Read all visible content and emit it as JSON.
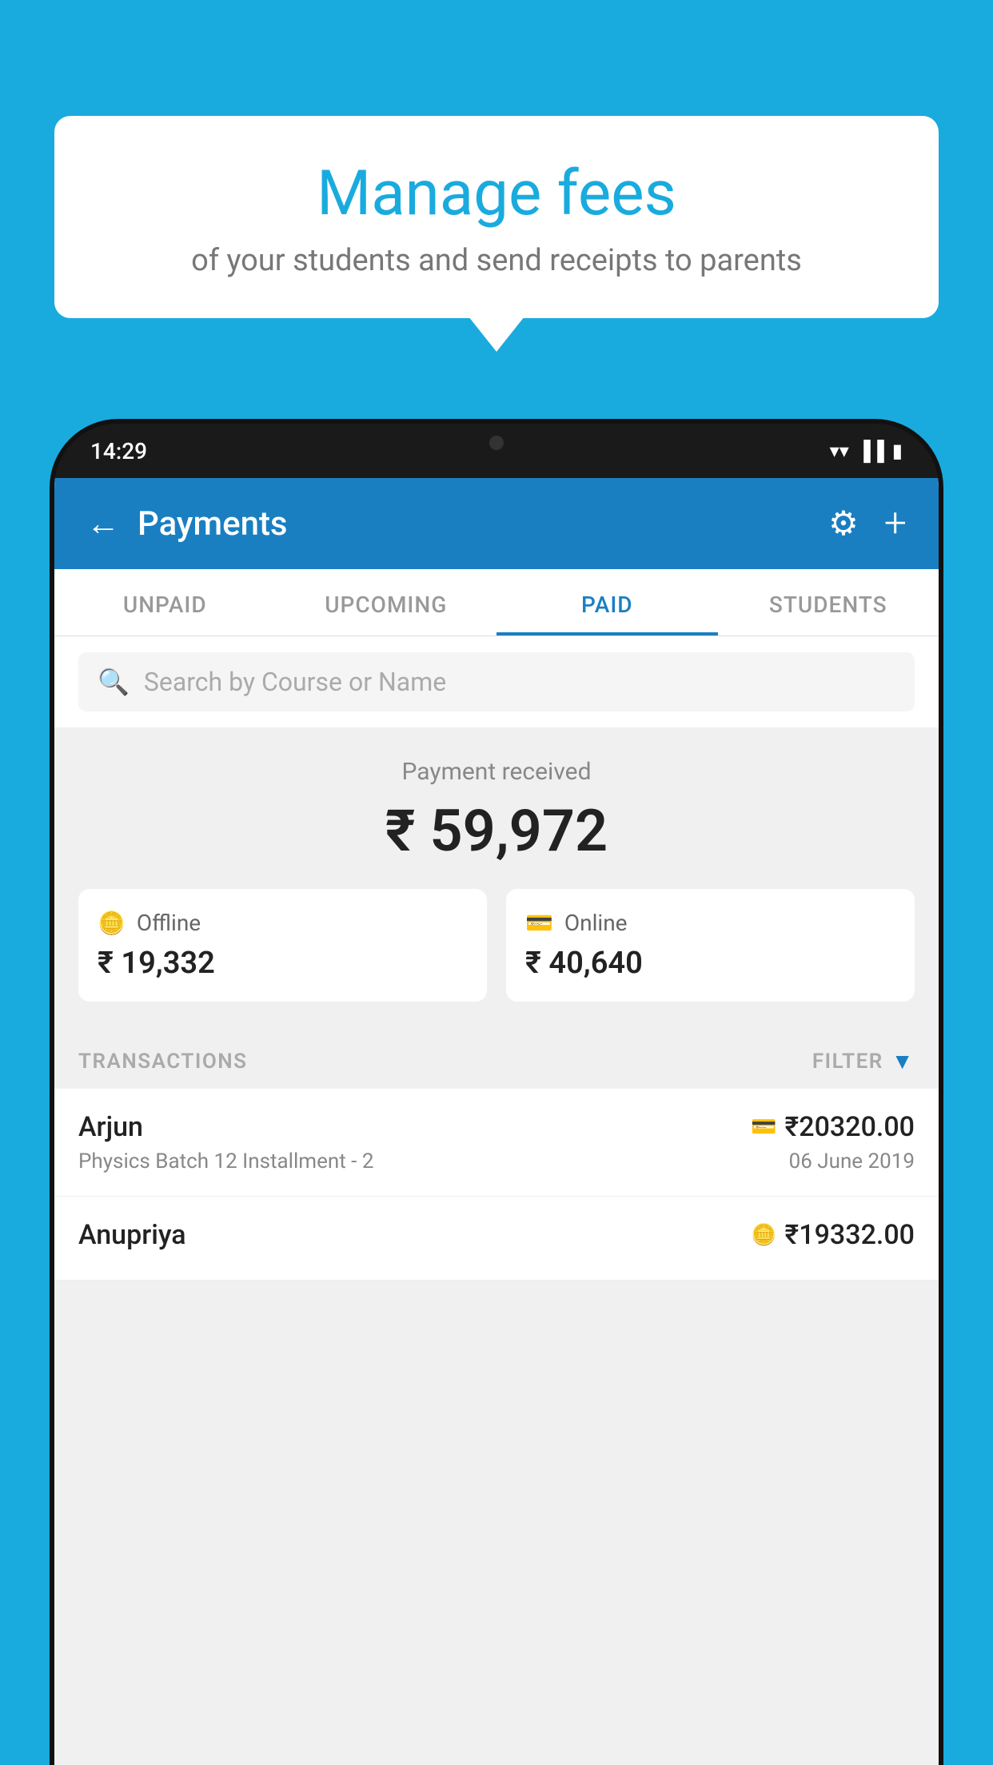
{
  "background_color": "#1AABDE",
  "speech_bubble": {
    "title": "Manage fees",
    "subtitle": "of your students and send receipts to parents"
  },
  "phone": {
    "status_bar": {
      "time": "14:29",
      "icons": [
        "wifi",
        "signal",
        "battery"
      ]
    },
    "header": {
      "title": "Payments",
      "back_label": "←",
      "gear_label": "⚙",
      "plus_label": "+"
    },
    "tabs": [
      {
        "label": "UNPAID",
        "active": false
      },
      {
        "label": "UPCOMING",
        "active": false
      },
      {
        "label": "PAID",
        "active": true
      },
      {
        "label": "STUDENTS",
        "active": false
      }
    ],
    "search": {
      "placeholder": "Search by Course or Name"
    },
    "payment_summary": {
      "label": "Payment received",
      "amount": "₹ 59,972",
      "offline": {
        "type": "Offline",
        "amount": "₹ 19,332"
      },
      "online": {
        "type": "Online",
        "amount": "₹ 40,640"
      }
    },
    "transactions": {
      "section_label": "TRANSACTIONS",
      "filter_label": "FILTER",
      "items": [
        {
          "name": "Arjun",
          "course": "Physics Batch 12 Installment - 2",
          "amount": "₹20320.00",
          "date": "06 June 2019",
          "payment_type": "online"
        },
        {
          "name": "Anupriya",
          "course": "",
          "amount": "₹19332.00",
          "date": "",
          "payment_type": "offline"
        }
      ]
    }
  }
}
